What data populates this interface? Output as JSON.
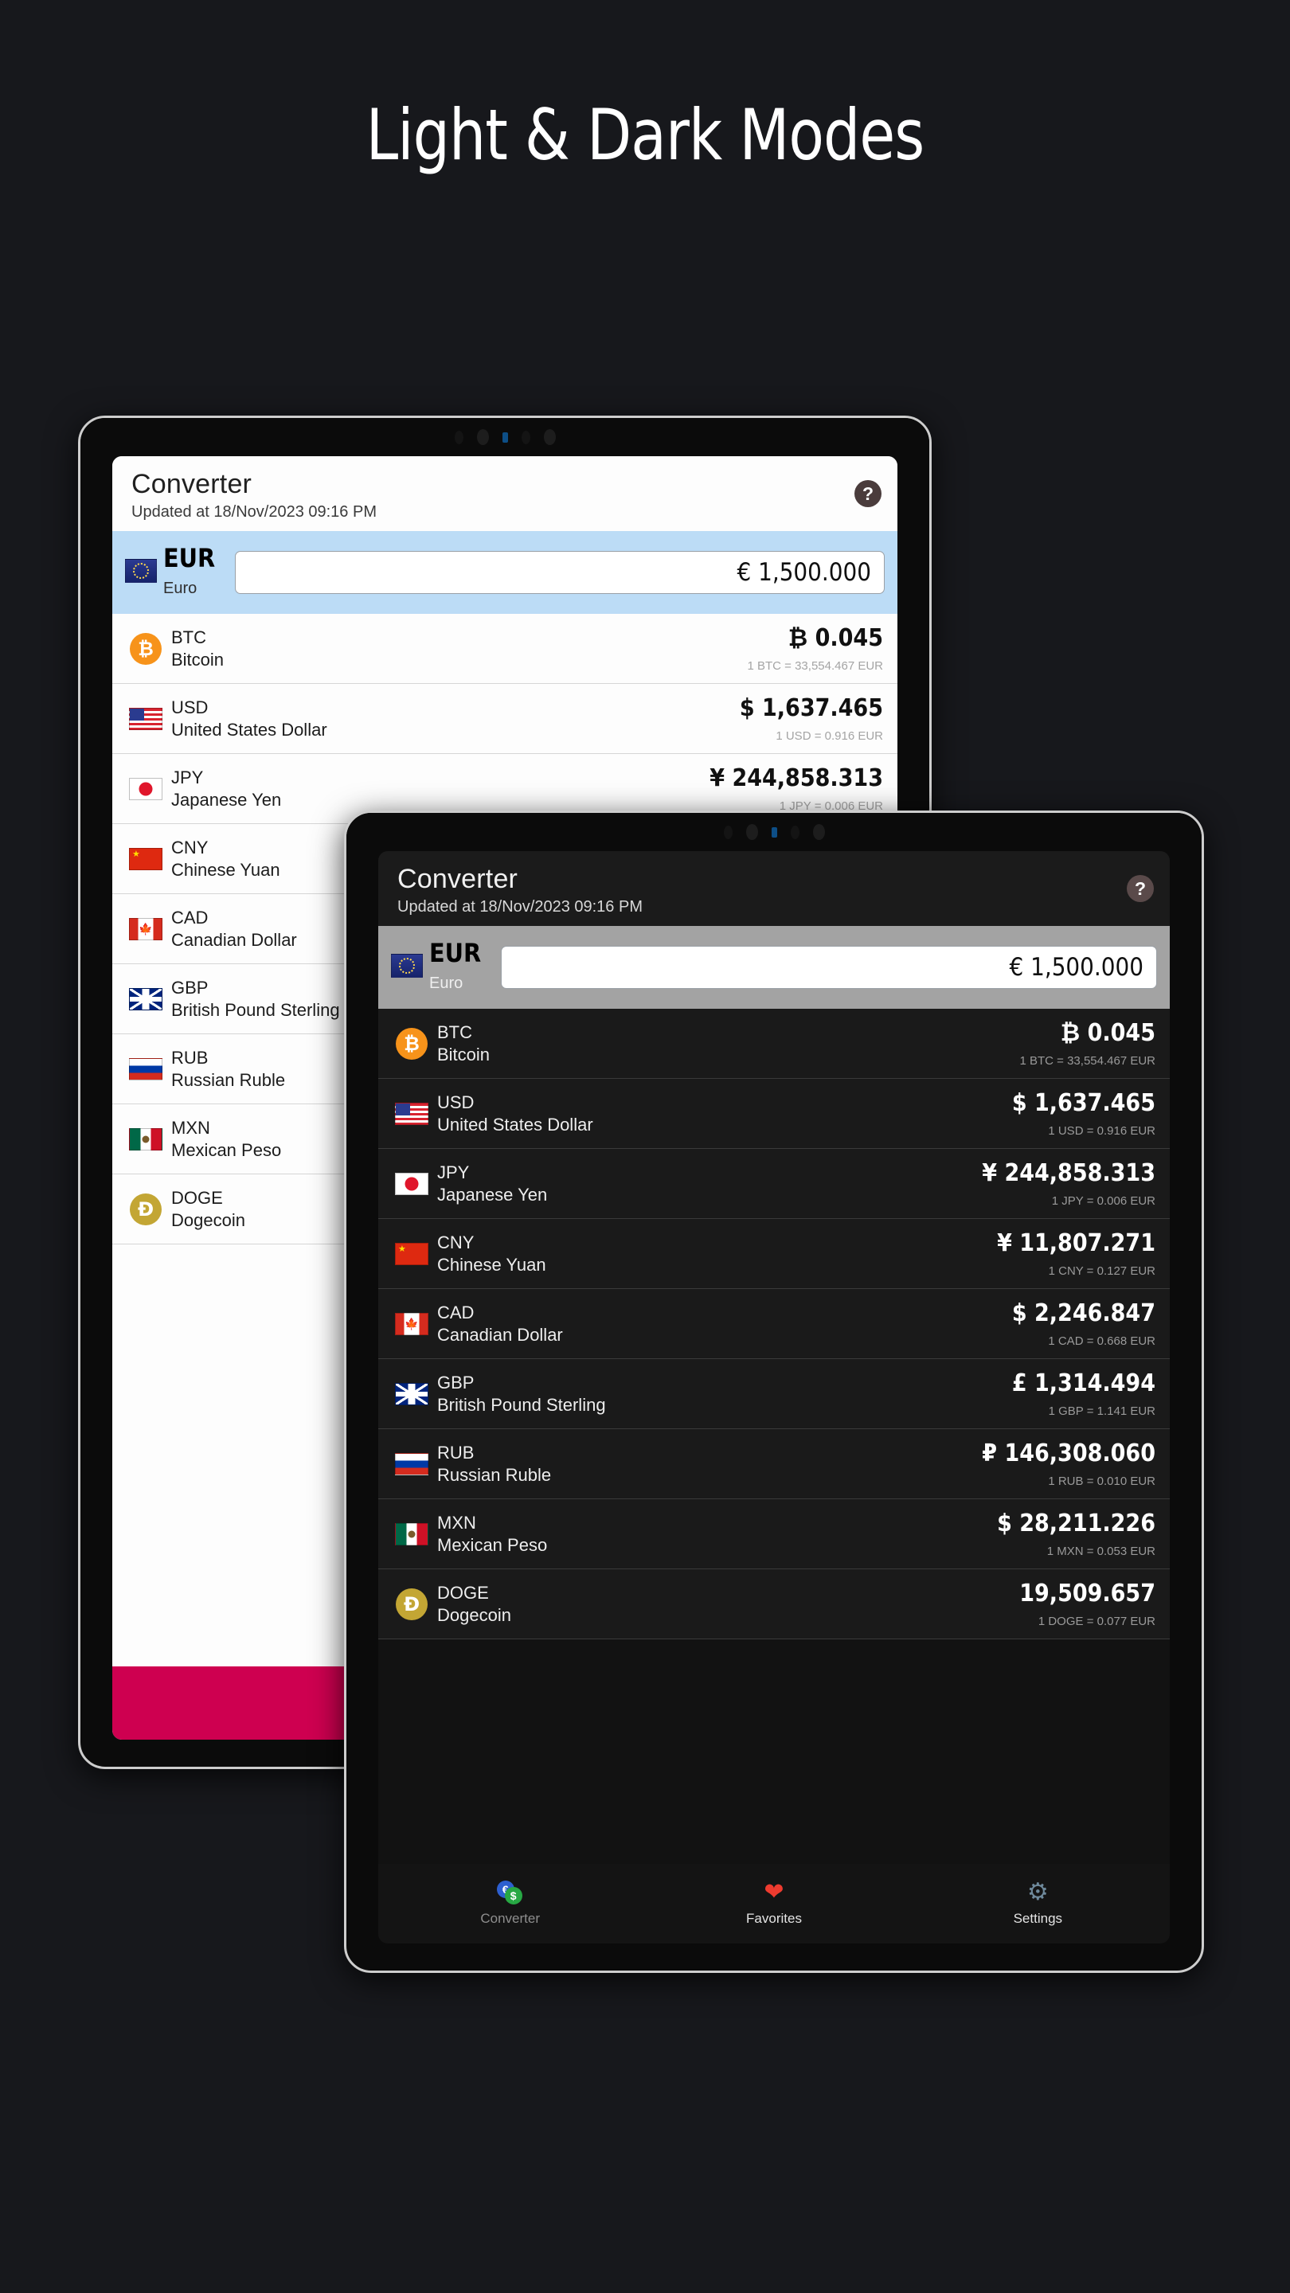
{
  "headline": "Light & Dark Modes",
  "colors": {
    "page_background": "#17181C",
    "light_accent_row": "#BCDCF6",
    "light_navbar": "#CE0050",
    "dark_base_row": "#A3A3A3",
    "dark_row": "#1A1A1A",
    "btc_orange": "#F7931A",
    "doge_gold": "#C3A634",
    "favorites_red": "#EE3B2F",
    "settings_blue": "#6F8A9C"
  },
  "app": {
    "title": "Converter",
    "updated": "Updated at 18/Nov/2023 09:16 PM",
    "help_icon": "question-mark-icon",
    "help_label": "?"
  },
  "base_currency": {
    "code": "EUR",
    "name": "Euro",
    "flag": "eu-flag",
    "value": "€ 1,500.000"
  },
  "currencies": [
    {
      "code": "BTC",
      "name": "Bitcoin",
      "flag": "btc-coin-icon",
      "glyph": "₿",
      "amount": "₿ 0.045",
      "rate": "1 BTC = 33,554.467 EUR"
    },
    {
      "code": "USD",
      "name": "United States Dollar",
      "flag": "us-flag",
      "glyph": "",
      "amount": "$ 1,637.465",
      "rate": "1 USD = 0.916 EUR"
    },
    {
      "code": "JPY",
      "name": "Japanese Yen",
      "flag": "jp-flag",
      "glyph": "",
      "amount": "¥ 244,858.313",
      "rate": "1 JPY = 0.006 EUR"
    },
    {
      "code": "CNY",
      "name": "Chinese Yuan",
      "flag": "cn-flag",
      "glyph": "",
      "amount": "¥ 11,807.271",
      "rate": "1 CNY = 0.127 EUR"
    },
    {
      "code": "CAD",
      "name": "Canadian Dollar",
      "flag": "ca-flag",
      "glyph": "",
      "amount": "$ 2,246.847",
      "rate": "1 CAD = 0.668 EUR"
    },
    {
      "code": "GBP",
      "name": "British Pound Sterling",
      "flag": "gb-flag",
      "glyph": "",
      "amount": "£ 1,314.494",
      "rate": "1 GBP = 1.141 EUR"
    },
    {
      "code": "RUB",
      "name": "Russian Ruble",
      "flag": "ru-flag",
      "glyph": "",
      "amount": "₽ 146,308.060",
      "rate": "1 RUB = 0.010 EUR"
    },
    {
      "code": "MXN",
      "name": "Mexican Peso",
      "flag": "mx-flag",
      "glyph": "",
      "amount": "$ 28,211.226",
      "rate": "1 MXN = 0.053 EUR"
    },
    {
      "code": "DOGE",
      "name": "Dogecoin",
      "flag": "doge-coin-icon",
      "glyph": "Ð",
      "amount": "19,509.657",
      "rate": "1 DOGE = 0.077 EUR"
    }
  ],
  "navbar": {
    "converter": {
      "label": "Converter",
      "icon": "coins-icon"
    },
    "favorites": {
      "label": "Favorites",
      "icon": "heart-icon"
    },
    "settings": {
      "label": "Settings",
      "icon": "gear-icon"
    }
  }
}
